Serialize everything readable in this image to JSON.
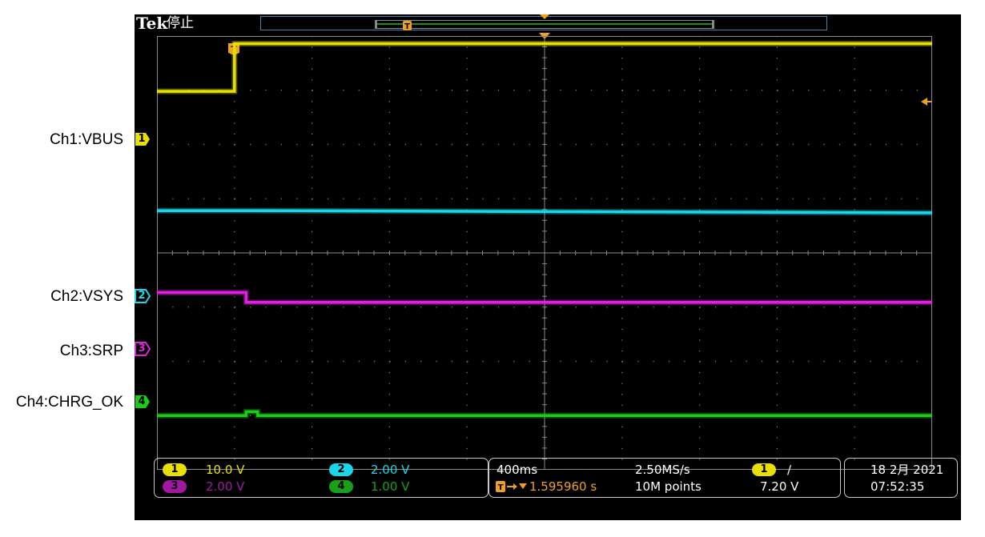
{
  "header": {
    "logo": "Tek",
    "status": "停止"
  },
  "channel_labels": [
    "Ch1:VBUS",
    "Ch2:VSYS",
    "Ch3:SRP",
    "Ch4:CHRG_OK"
  ],
  "channel_markers": [
    "1",
    "2",
    "3",
    "4"
  ],
  "colors": {
    "ch1": "#e8e000",
    "ch2": "#1ad6e8",
    "ch3": "#e020e0",
    "ch4": "#18cc18",
    "trigger": "#f0a020",
    "grid": "#8a8a8a",
    "panel_text": "#ffffff"
  },
  "channel_settings": [
    {
      "channel": "1",
      "scale": "10.0 V"
    },
    {
      "channel": "2",
      "scale": "2.00 V"
    },
    {
      "channel": "3",
      "scale": "2.00 V"
    },
    {
      "channel": "4",
      "scale": "1.00 V"
    }
  ],
  "timebase": {
    "horizontal_scale": "400ms",
    "sample_rate": "2.50MS/s",
    "trigger_delay": "1.595960 s",
    "record_length": "10M points"
  },
  "trigger": {
    "source": "1",
    "slope_icon": "rising-edge-icon",
    "slope_glyph": "∕",
    "level": "7.20 V"
  },
  "datetime": {
    "date": "18 2月 2021",
    "time": "07:52:35"
  },
  "chart_data": {
    "type": "line",
    "title": "",
    "xlabel": "",
    "ylabel": "",
    "grid": true,
    "divisions": {
      "x": 10,
      "y": 8
    },
    "x_unit": "s",
    "xlim": [
      -0.4,
      3.6
    ],
    "ylim": [
      -4,
      4
    ],
    "series": [
      {
        "name": "Ch1:VBUS",
        "color": "#e8e000",
        "x": [
          -0.4,
          0.0,
          0.0,
          3.6
        ],
        "y": [
          2.98,
          2.98,
          3.86,
          3.86
        ]
      },
      {
        "name": "Ch2:VSYS",
        "color": "#1ad6e8",
        "x": [
          -0.4,
          0.1,
          3.6
        ],
        "y": [
          0.78,
          0.78,
          0.74
        ]
      },
      {
        "name": "Ch3:SRP",
        "color": "#e020e0",
        "x": [
          -0.4,
          0.06,
          0.06,
          3.6
        ],
        "y": [
          -0.73,
          -0.73,
          -0.91,
          -0.91
        ]
      },
      {
        "name": "Ch4:CHRG_OK",
        "color": "#18cc18",
        "x": [
          -0.4,
          0.06,
          0.06,
          0.12,
          0.12,
          3.6
        ],
        "y": [
          -3.0,
          -3.0,
          -2.93,
          -2.93,
          -3.0,
          -3.0
        ]
      }
    ]
  }
}
